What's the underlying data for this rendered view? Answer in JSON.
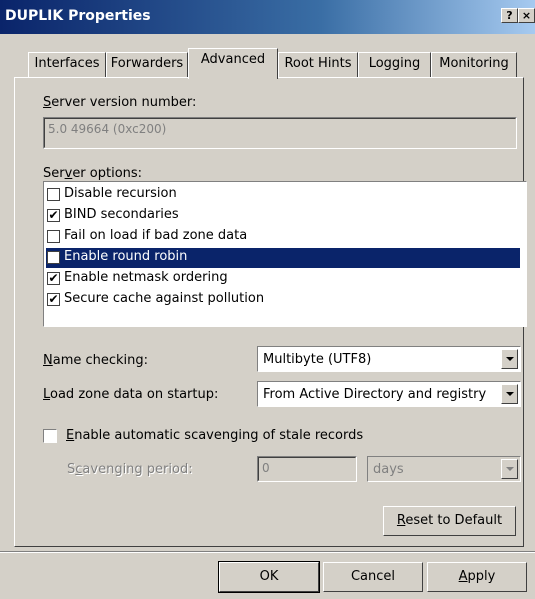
{
  "window": {
    "title": "DUPLIK Properties",
    "help_button": "?",
    "close_button": "×"
  },
  "tabs": [
    {
      "label": "Interfaces"
    },
    {
      "label": "Forwarders"
    },
    {
      "label": "Advanced",
      "active": true
    },
    {
      "label": "Root Hints"
    },
    {
      "label": "Logging"
    },
    {
      "label": "Monitoring"
    }
  ],
  "advanced": {
    "server_version_label_access": "S",
    "server_version_label_rest": "erver version number:",
    "server_version_value": "5.0 49664 (0xc200)",
    "server_options_label_pre": "Ser",
    "server_options_label_access": "v",
    "server_options_label_post": "er options:",
    "server_options": [
      {
        "label": "Disable recursion",
        "checked": false,
        "selected": false
      },
      {
        "label": "BIND secondaries",
        "checked": true,
        "selected": false
      },
      {
        "label": "Fail on load if bad zone data",
        "checked": false,
        "selected": false
      },
      {
        "label": "Enable round robin",
        "checked": false,
        "selected": true
      },
      {
        "label": "Enable netmask ordering",
        "checked": true,
        "selected": false
      },
      {
        "label": "Secure cache against pollution",
        "checked": true,
        "selected": false
      }
    ],
    "name_checking_access": "N",
    "name_checking_rest": "ame checking:",
    "name_checking_value": "Multibyte (UTF8)",
    "load_zone_access": "L",
    "load_zone_rest": "oad zone data on startup:",
    "load_zone_value": "From Active Directory and registry",
    "scavenging_checkbox_access": "E",
    "scavenging_checkbox_rest": "nable automatic scavenging of stale records",
    "scavenging_checked": false,
    "scavenging_period_pre": "S",
    "scavenging_period_access": "c",
    "scavenging_period_post": "avenging period:",
    "scavenging_period_value": "0",
    "scavenging_unit_value": "days",
    "reset_button_access": "R",
    "reset_button_rest": "eset to Default"
  },
  "footer": {
    "ok_label": "OK",
    "cancel_label": "Cancel",
    "apply_access": "A",
    "apply_rest": "pply"
  },
  "colors": {
    "dialog_face": "#d4d0c8",
    "title_bar": "#0a246a",
    "selection": "#0a246a"
  }
}
